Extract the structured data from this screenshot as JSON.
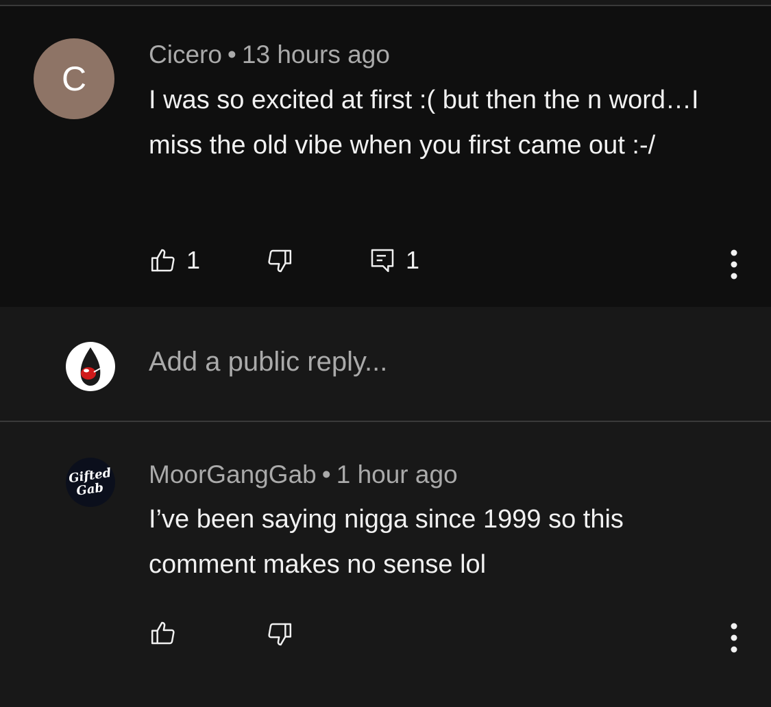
{
  "parent_comment": {
    "avatar_letter": "C",
    "author": "Cicero",
    "separator": "•",
    "time": "13 hours ago",
    "text": "I was so excited at first :( but then the n word…I miss the old vibe when you first came out :-/",
    "like_count": "1",
    "reply_count": "1"
  },
  "reply_box": {
    "placeholder": "Add a public reply..."
  },
  "child_comment": {
    "avatar_logo_text": "Gifted Gab",
    "author": "MoorGangGab",
    "separator": "•",
    "time": "1 hour ago",
    "text": "I’ve been saying nigga since 1999 so this comment makes no sense lol"
  },
  "colors": {
    "parent_background": "#0f0f0f",
    "page_background": "#181818",
    "meta_text": "#aaaaaa",
    "body_text": "#f1f1f1",
    "avatar_c": "#8e7466"
  },
  "icons": [
    "thumbs-up-icon",
    "thumbs-down-icon",
    "comment-reply-icon",
    "more-vertical-icon"
  ]
}
